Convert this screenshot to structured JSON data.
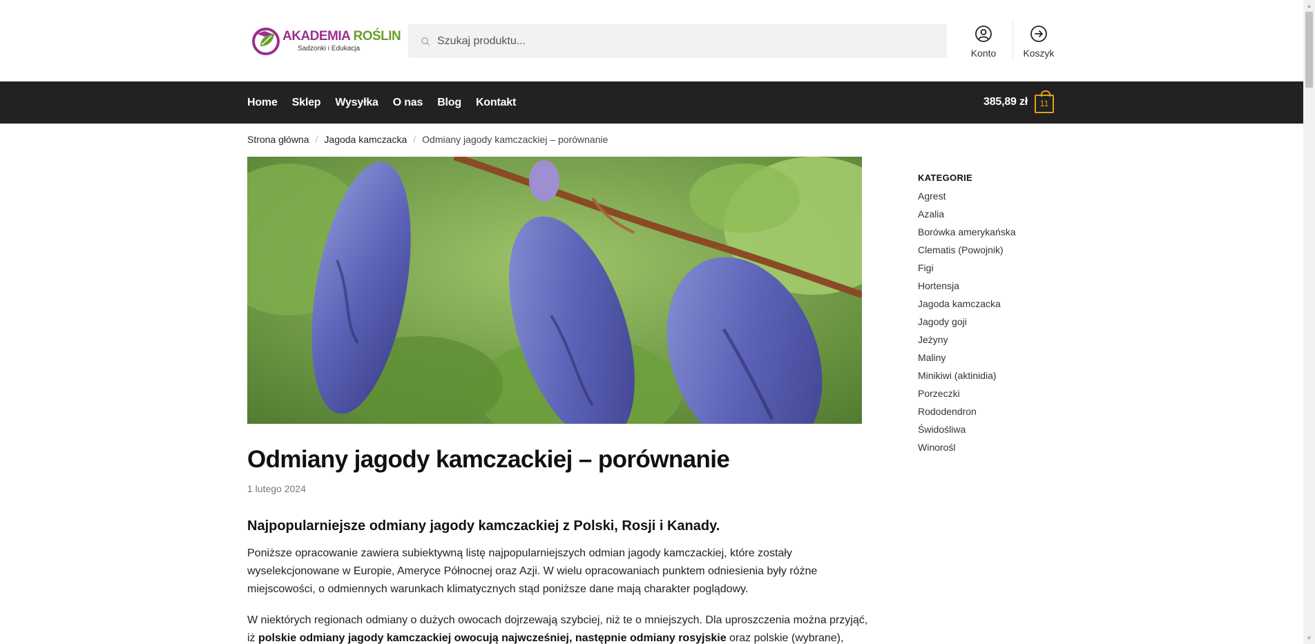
{
  "brand": {
    "title_part1": "AKADEMIA ",
    "title_part2": "ROŚLIN",
    "subtitle": "Sadzonki i Edukacja"
  },
  "search": {
    "placeholder": "Szukaj produktu...",
    "icon": "search-icon"
  },
  "header_links": {
    "account_label": "Konto",
    "account_icon": "user-circle-icon",
    "cart_label": "Koszyk",
    "cart_icon": "arrow-right-circle-icon"
  },
  "nav": {
    "items": [
      "Home",
      "Sklep",
      "Wysyłka",
      "O nas",
      "Blog",
      "Kontakt"
    ],
    "cart_total": "385,89 zł",
    "cart_count": "11"
  },
  "breadcrumb": {
    "items": [
      "Strona główna",
      "Jagoda kamczacka"
    ],
    "current": "Odmiany jagody kamczackiej – porównanie"
  },
  "post": {
    "title": "Odmiany jagody kamczackiej – porównanie",
    "date": "1 lutego 2024",
    "subtitle": "Najpopularniejsze odmiany jagody kamczackiej z Polski, Rosji i Kanady.",
    "p1": "Poniższe opracowanie zawiera subiektywną listę najpopularniejszych odmian jagody kamczackiej, które zostały wyselekcjonowane w Europie, Ameryce Północnej oraz Azji.  W wielu opracowaniach punktem odniesienia były różne miejscowości, o odmiennych warunkach klimatycznych stąd poniższe dane mają charakter poglądowy.",
    "p2_a": "W niektórych regionach odmiany o dużych owocach dojrzewają szybciej, niż te o mniejszych. Dla uproszczenia można przyjąć, iż ",
    "p2_b": "polskie odmiany jagody kamczackiej owocują najwcześniej, następnie odmiany rosyjskie",
    "p2_c": " oraz polskie (wybrane),"
  },
  "sidebar": {
    "title": "KATEGORIE",
    "categories": [
      "Agrest",
      "Azalia",
      "Borówka amerykańska",
      "Clematis (Powojnik)",
      "Figi",
      "Hortensja",
      "Jagoda kamczacka",
      "Jagody goji",
      "Jeżyny",
      "Maliny",
      "Minikiwi (aktinidia)",
      "Porzeczki",
      "Rododendron",
      "Świdośliwa",
      "Winorośl"
    ]
  },
  "colors": {
    "nav_bg": "#222222",
    "accent": "#e0a21a",
    "brand_purple": "#9b2f8e",
    "brand_green": "#6a9e2a"
  }
}
